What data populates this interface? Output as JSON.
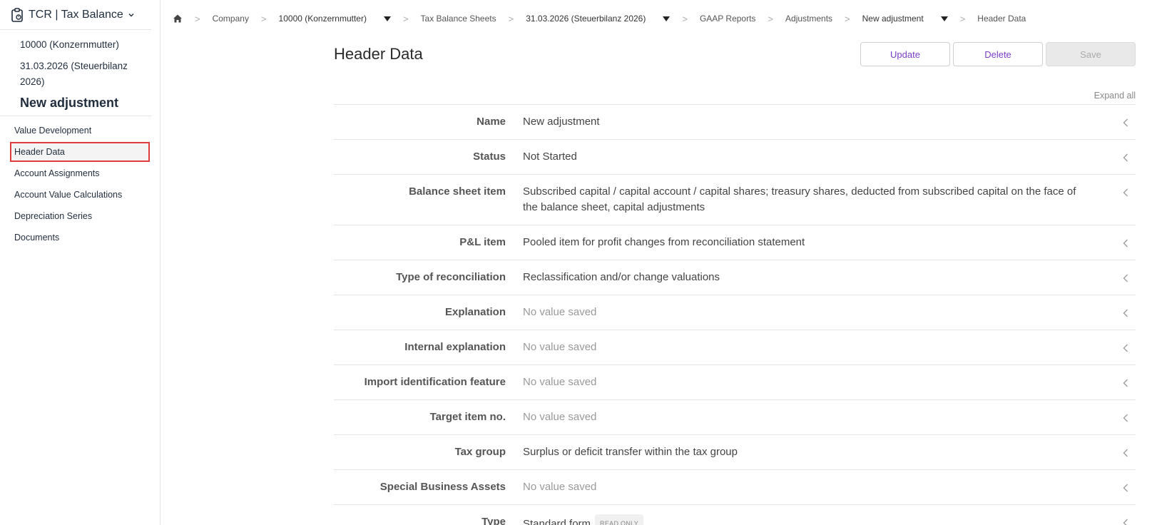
{
  "app": {
    "title": "TCR | Tax Balance"
  },
  "sidebar": {
    "context": {
      "company": "10000 (Konzernmutter)",
      "sheet": "31.03.2026 (Steuerbilanz 2026)",
      "title": "New adjustment"
    },
    "items": [
      {
        "label": "Value Development",
        "active": false
      },
      {
        "label": "Header Data",
        "active": true
      },
      {
        "label": "Account Assignments",
        "active": false
      },
      {
        "label": "Account Value Calculations",
        "active": false
      },
      {
        "label": "Depreciation Series",
        "active": false
      },
      {
        "label": "Documents",
        "active": false
      }
    ]
  },
  "breadcrumb": {
    "items": [
      "Company",
      "10000 (Konzernmutter)",
      "Tax Balance Sheets",
      "31.03.2026 (Steuerbilanz 2026)",
      "GAAP Reports",
      "Adjustments",
      "New adjustment",
      "Header Data"
    ]
  },
  "main": {
    "title": "Header Data",
    "buttons": {
      "update": "Update",
      "delete": "Delete",
      "save": "Save"
    },
    "expand_all": "Expand all",
    "rows": [
      {
        "label": "Name",
        "value": "New adjustment",
        "empty": false
      },
      {
        "label": "Status",
        "value": "Not Started",
        "empty": false
      },
      {
        "label": "Balance sheet item",
        "value": "Subscribed capital / capital account / capital shares; treasury shares, deducted from subscribed capital on the face of the balance sheet, capital adjustments",
        "empty": false
      },
      {
        "label": "P&L item",
        "value": "Pooled item for profit changes from reconciliation statement",
        "empty": false
      },
      {
        "label": "Type of reconciliation",
        "value": "Reclassification and/or change valuations",
        "empty": false
      },
      {
        "label": "Explanation",
        "value": "No value saved",
        "empty": true
      },
      {
        "label": "Internal explanation",
        "value": "No value saved",
        "empty": true
      },
      {
        "label": "Import identification feature",
        "value": "No value saved",
        "empty": true
      },
      {
        "label": "Target item no.",
        "value": "No value saved",
        "empty": true
      },
      {
        "label": "Tax group",
        "value": "Surplus or deficit transfer within the tax group",
        "empty": false
      },
      {
        "label": "Special Business Assets",
        "value": "No value saved",
        "empty": true
      },
      {
        "label": "Type",
        "value": "Standard form",
        "empty": false,
        "badge": "READ ONLY"
      }
    ]
  },
  "colors": {
    "accent": "#7a3fc8",
    "highlight": "#e03c3c"
  }
}
